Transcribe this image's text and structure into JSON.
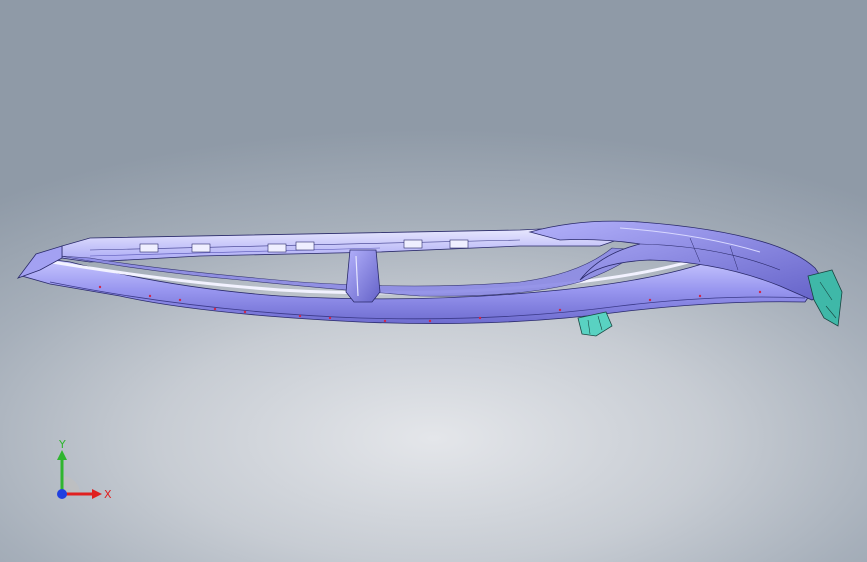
{
  "viewport": {
    "background_top": "#8f9aa7",
    "background_bottom": "#e4e6ea",
    "model": {
      "body_color": "#9a98f2",
      "highlight_color": "#dcdcff",
      "edge_color": "#2a2a6a",
      "bracket_color": "#59d2c2"
    },
    "triad": {
      "y_label": "Y",
      "x_label": "X",
      "y_color": "#2fb52f",
      "x_color": "#e02020",
      "z_color": "#2040e0"
    }
  }
}
